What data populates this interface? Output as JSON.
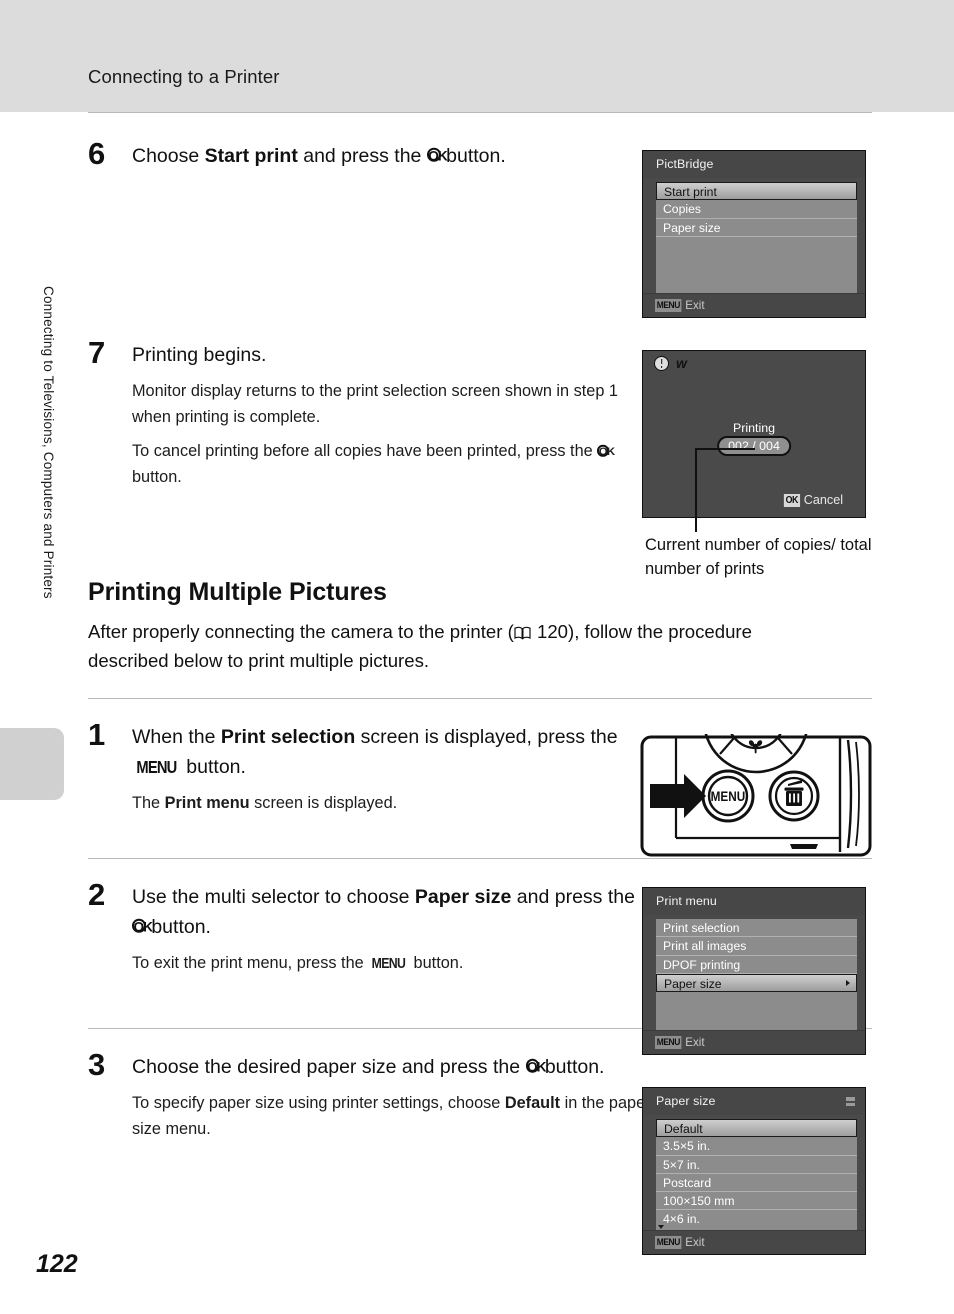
{
  "header": {
    "title": "Connecting to a Printer"
  },
  "side_tab": {
    "text": "Connecting to Televisions, Computers and Printers"
  },
  "page_number": "122",
  "steps": {
    "step6": {
      "number": "6",
      "title_pre": "Choose ",
      "title_bold": "Start print",
      "title_mid": " and press the ",
      "title_post": " button."
    },
    "step7": {
      "number": "7",
      "title": "Printing begins.",
      "note1": "Monitor display returns to the print selection screen shown in step 1 when printing is complete.",
      "note2_pre": "To cancel printing before all copies have been printed, press the ",
      "note2_post": " button."
    },
    "step1": {
      "number": "1",
      "title_pre": "When the ",
      "title_bold": "Print selection",
      "title_mid": " screen is displayed, press the ",
      "title_post": " button.",
      "note_pre": "The ",
      "note_bold": "Print menu",
      "note_post": " screen is displayed."
    },
    "step2": {
      "number": "2",
      "title_pre": "Use the multi selector to choose ",
      "title_bold": "Paper size",
      "title_mid": " and press the ",
      "title_post": " button.",
      "note_pre": "To exit the print menu, press the ",
      "note_post": " button."
    },
    "step3": {
      "number": "3",
      "title_pre": "Choose the desired paper size and press the ",
      "title_post": " button.",
      "note_pre": "To specify paper size using printer settings, choose ",
      "note_bold": "Default",
      "note_post": " in the paper size menu."
    }
  },
  "section": {
    "heading": "Printing Multiple Pictures",
    "intro_pre": "After properly connecting the camera to the printer (",
    "intro_ref": " 120), follow the procedure described below to print multiple pictures."
  },
  "callout": {
    "caption": "Current number of copies/ total number of prints"
  },
  "screens": {
    "pictbridge": {
      "title": "PictBridge",
      "items": [
        {
          "label": "Start print",
          "selected": true
        },
        {
          "label": "Copies",
          "selected": false
        },
        {
          "label": "Paper size",
          "selected": false
        }
      ],
      "footer_chip": "MENU",
      "footer_label": "Exit"
    },
    "printing": {
      "status": "Printing",
      "counter": "002 / 004",
      "cancel_chip": "OK",
      "cancel_label": "Cancel"
    },
    "print_menu": {
      "title": "Print menu",
      "items": [
        {
          "label": "Print selection",
          "selected": false,
          "arrow": false
        },
        {
          "label": "Print all images",
          "selected": false,
          "arrow": false
        },
        {
          "label": "DPOF printing",
          "selected": false,
          "arrow": false
        },
        {
          "label": "Paper size",
          "selected": true,
          "arrow": true
        }
      ],
      "footer_chip": "MENU",
      "footer_label": "Exit"
    },
    "paper_size": {
      "title": "Paper size",
      "items": [
        {
          "label": "Default",
          "selected": true
        },
        {
          "label": "3.5×5 in.",
          "selected": false
        },
        {
          "label": "5×7 in.",
          "selected": false
        },
        {
          "label": "Postcard",
          "selected": false
        },
        {
          "label": "100×150 mm",
          "selected": false
        },
        {
          "label": "4×6 in.",
          "selected": false
        }
      ],
      "footer_chip": "MENU",
      "footer_label": "Exit"
    }
  },
  "camera_illustration": {
    "menu_button_label": "MENU"
  },
  "colors": {
    "header_band": "#dcdcdc",
    "lcd_body": "#4a4a4a",
    "lcd_list": "#8c8c8c",
    "rule": "#b9b9b9"
  }
}
